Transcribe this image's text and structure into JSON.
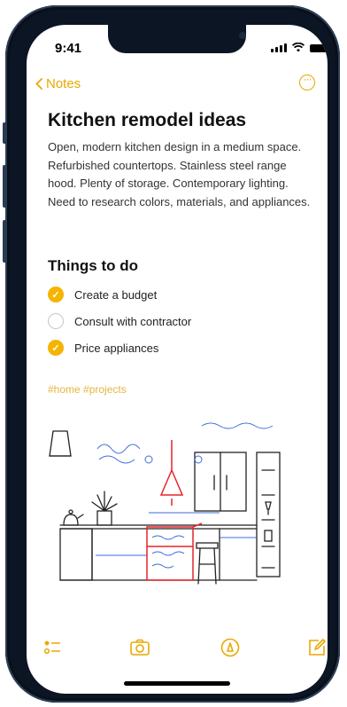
{
  "status_bar": {
    "time": "9:41"
  },
  "nav": {
    "back_label": "Notes",
    "more_icon": "ellipsis-circle-icon"
  },
  "note": {
    "title": "Kitchen remodel ideas",
    "body": "Open, modern kitchen design in a medium space. Refurbished countertops. Stainless steel range hood. Plenty of storage. Contemporary lighting. Need to research colors, materials, and appliances.",
    "checklist_heading": "Things to do",
    "checklist": [
      {
        "label": "Create a budget",
        "checked": true
      },
      {
        "label": "Consult with contractor",
        "checked": false
      },
      {
        "label": "Price appliances",
        "checked": true
      }
    ],
    "tags": "#home #projects"
  },
  "toolbar": {
    "icons": [
      "checklist-icon",
      "camera-icon",
      "markup-icon",
      "compose-icon"
    ]
  },
  "colors": {
    "accent": "#e9a800",
    "check_fill": "#f5b400",
    "tag": "#e3b640",
    "sketch_red": "#e8232a",
    "sketch_blue": "#2a5bd7"
  }
}
